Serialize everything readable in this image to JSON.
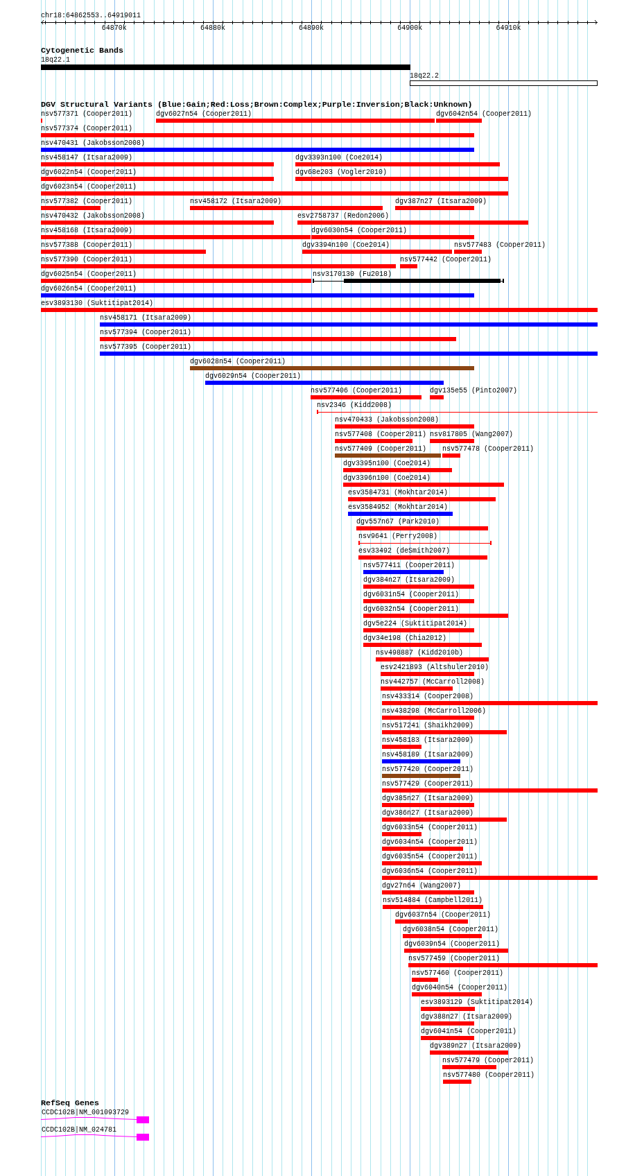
{
  "ruler": {
    "label": "chr18:64862553..64919011",
    "ticks": [
      "64870k",
      "64880k",
      "64890k",
      "64900k",
      "64910k"
    ]
  },
  "cytogenetic_bands": {
    "title": "Cytogenetic Bands",
    "bands": [
      {
        "label": "18q22.1",
        "color": "#000000"
      },
      {
        "label": "18q22.2",
        "color": "#ffffff"
      }
    ]
  },
  "dgv_variants": {
    "title": "DGV Structural Variants (Blue:Gain;Red:Loss;Brown:Complex;Purple:Inversion;Black:Unknown)",
    "rows": [
      {
        "features": [
          {
            "label": "nsv577371 (Cooper2011)",
            "color": "#ff0000",
            "kind": "bar"
          },
          {
            "label": "dgv6027n54 (Cooper2011)",
            "color": "#ff0000",
            "kind": "bar"
          },
          {
            "label": "dgv6042n54 (Cooper2011)",
            "color": "#ff0000",
            "kind": "bar"
          }
        ]
      },
      {
        "features": [
          {
            "label": "nsv577374 (Cooper2011)",
            "color": "#ff0000",
            "kind": "bar"
          }
        ]
      },
      {
        "features": [
          {
            "label": "nsv470431 (Jakobsson2008)",
            "color": "#0000ff",
            "kind": "bar"
          }
        ]
      },
      {
        "features": [
          {
            "label": "nsv458147 (Itsara2009)",
            "color": "#ff0000",
            "kind": "bar"
          },
          {
            "label": "dgv3393n100 (Coe2014)",
            "color": "#ff0000",
            "kind": "bar"
          }
        ]
      },
      {
        "features": [
          {
            "label": "dgv6022n54 (Cooper2011)",
            "color": "#ff0000",
            "kind": "bar"
          },
          {
            "label": "dgv68e203 (Vogler2010)",
            "color": "#ff0000",
            "kind": "bar"
          }
        ]
      },
      {
        "features": [
          {
            "label": "dgv6023n54 (Cooper2011)",
            "color": "#ff0000",
            "kind": "bar"
          }
        ]
      },
      {
        "features": [
          {
            "label": "nsv577382 (Cooper2011)",
            "color": "#ff0000",
            "kind": "bar"
          },
          {
            "label": "nsv458172 (Itsara2009)",
            "color": "#ff0000",
            "kind": "bar"
          },
          {
            "label": "dgv387n27 (Itsara2009)",
            "color": "#ff0000",
            "kind": "bar"
          }
        ]
      },
      {
        "features": [
          {
            "label": "nsv470432 (Jakobsson2008)",
            "color": "#ff0000",
            "kind": "bar"
          },
          {
            "label": "esv2758737 (Redon2006)",
            "color": "#ff0000",
            "kind": "bar"
          }
        ]
      },
      {
        "features": [
          {
            "label": "nsv458168 (Itsara2009)",
            "color": "#ff0000",
            "kind": "bar"
          },
          {
            "label": "dgv6030n54 (Cooper2011)",
            "color": "#ff0000",
            "kind": "bar"
          }
        ]
      },
      {
        "features": [
          {
            "label": "nsv577388 (Cooper2011)",
            "color": "#ff0000",
            "kind": "bar"
          },
          {
            "label": "dgv3394n100 (Coe2014)",
            "color": "#ff0000",
            "kind": "bar"
          },
          {
            "label": "nsv577483 (Cooper2011)",
            "color": "#ff0000",
            "kind": "bar"
          }
        ]
      },
      {
        "features": [
          {
            "label": "nsv577390 (Cooper2011)",
            "color": "#ff0000",
            "kind": "bar"
          },
          {
            "label": "nsv577442 (Cooper2011)",
            "color": "#ff0000",
            "kind": "bar"
          }
        ]
      },
      {
        "features": [
          {
            "label": "dgv6025n54 (Cooper2011)",
            "color": "#ff0000",
            "kind": "bar"
          },
          {
            "label": "nsv3170130 (Fu2018)",
            "color": "#000000",
            "kind": "partial"
          }
        ]
      },
      {
        "features": [
          {
            "label": "dgv6026n54 (Cooper2011)",
            "color": "#0000ff",
            "kind": "bar"
          }
        ]
      },
      {
        "features": [
          {
            "label": "esv3893130 (Suktitipat2014)",
            "color": "#ff0000",
            "kind": "bar"
          }
        ]
      },
      {
        "features": [
          {
            "label": "nsv458171 (Itsara2009)",
            "color": "#0000ff",
            "kind": "bar"
          }
        ]
      },
      {
        "features": [
          {
            "label": "nsv577394 (Cooper2011)",
            "color": "#ff0000",
            "kind": "bar"
          }
        ]
      },
      {
        "features": [
          {
            "label": "nsv577395 (Cooper2011)",
            "color": "#0000ff",
            "kind": "bar"
          }
        ]
      },
      {
        "features": [
          {
            "label": "dgv6028n54 (Cooper2011)",
            "color": "#8b4513",
            "kind": "bar"
          }
        ]
      },
      {
        "features": [
          {
            "label": "dgv6029n54 (Cooper2011)",
            "color": "#0000ff",
            "kind": "bar"
          }
        ]
      },
      {
        "features": [
          {
            "label": "nsv577406 (Cooper2011)",
            "color": "#ff0000",
            "kind": "bar"
          },
          {
            "label": "dgv135e55 (Pinto2007)",
            "color": "#ff0000",
            "kind": "bar"
          }
        ]
      },
      {
        "features": [
          {
            "label": "nsv2346 (Kidd2008)",
            "color": "#ff0000",
            "kind": "line"
          }
        ]
      },
      {
        "features": [
          {
            "label": "nsv470433 (Jakobsson2008)",
            "color": "#ff0000",
            "kind": "bar"
          }
        ]
      },
      {
        "features": [
          {
            "label": "nsv577408 (Cooper2011)",
            "color": "#ff0000",
            "kind": "bar"
          },
          {
            "label": "nsv817805 (Wang2007)",
            "color": "#ff0000",
            "kind": "bar"
          }
        ]
      },
      {
        "features": [
          {
            "label": "nsv577409 (Cooper2011)",
            "color": "#8b4513",
            "kind": "bar"
          },
          {
            "label": "nsv577478 (Cooper2011)",
            "color": "#ff0000",
            "kind": "bar"
          }
        ]
      },
      {
        "features": [
          {
            "label": "dgv3395n100 (Coe2014)",
            "color": "#ff0000",
            "kind": "bar"
          }
        ]
      },
      {
        "features": [
          {
            "label": "dgv3396n100 (Coe2014)",
            "color": "#ff0000",
            "kind": "bar"
          }
        ]
      },
      {
        "features": [
          {
            "label": "esv3584731 (Mokhtar2014)",
            "color": "#ff0000",
            "kind": "bar"
          }
        ]
      },
      {
        "features": [
          {
            "label": "esv3584952 (Mokhtar2014)",
            "color": "#0000ff",
            "kind": "bar"
          }
        ]
      },
      {
        "features": [
          {
            "label": "dgv557n67 (Park2010)",
            "color": "#ff0000",
            "kind": "bar"
          }
        ]
      },
      {
        "features": [
          {
            "label": "nsv9641 (Perry2008)",
            "color": "#ff0000",
            "kind": "line"
          }
        ]
      },
      {
        "features": [
          {
            "label": "esv33492 (deSmith2007)",
            "color": "#ff0000",
            "kind": "bar"
          }
        ]
      },
      {
        "features": [
          {
            "label": "nsv577411 (Cooper2011)",
            "color": "#0000ff",
            "kind": "bar"
          }
        ]
      },
      {
        "features": [
          {
            "label": "dgv384n27 (Itsara2009)",
            "color": "#ff0000",
            "kind": "bar"
          }
        ]
      },
      {
        "features": [
          {
            "label": "dgv6031n54 (Cooper2011)",
            "color": "#ff0000",
            "kind": "bar"
          }
        ]
      },
      {
        "features": [
          {
            "label": "dgv6032n54 (Cooper2011)",
            "color": "#ff0000",
            "kind": "bar"
          }
        ]
      },
      {
        "features": [
          {
            "label": "dgv5e224 (Suktitipat2014)",
            "color": "#ff0000",
            "kind": "bar"
          }
        ]
      },
      {
        "features": [
          {
            "label": "dgv34e198 (Chia2012)",
            "color": "#ff0000",
            "kind": "bar"
          }
        ]
      },
      {
        "features": [
          {
            "label": "nsv498887 (Kidd2010b)",
            "color": "#ff0000",
            "kind": "bar"
          }
        ]
      },
      {
        "features": [
          {
            "label": "esv2421893 (Altshuler2010)",
            "color": "#ff0000",
            "kind": "bar"
          }
        ]
      },
      {
        "features": [
          {
            "label": "nsv442757 (McCarroll2008)",
            "color": "#ff0000",
            "kind": "bar"
          }
        ]
      },
      {
        "features": [
          {
            "label": "nsv433314 (Cooper2008)",
            "color": "#ff0000",
            "kind": "bar"
          }
        ]
      },
      {
        "features": [
          {
            "label": "nsv438298 (McCarroll2006)",
            "color": "#ff0000",
            "kind": "bar"
          }
        ]
      },
      {
        "features": [
          {
            "label": "nsv517241 (Shaikh2009)",
            "color": "#ff0000",
            "kind": "bar"
          }
        ]
      },
      {
        "features": [
          {
            "label": "nsv458183 (Itsara2009)",
            "color": "#ff0000",
            "kind": "bar"
          }
        ]
      },
      {
        "features": [
          {
            "label": "nsv458189 (Itsara2009)",
            "color": "#0000ff",
            "kind": "bar"
          }
        ]
      },
      {
        "features": [
          {
            "label": "nsv577420 (Cooper2011)",
            "color": "#8b4513",
            "kind": "bar"
          }
        ]
      },
      {
        "features": [
          {
            "label": "nsv577429 (Cooper2011)",
            "color": "#ff0000",
            "kind": "bar"
          }
        ]
      },
      {
        "features": [
          {
            "label": "dgv385n27 (Itsara2009)",
            "color": "#ff0000",
            "kind": "bar"
          }
        ]
      },
      {
        "features": [
          {
            "label": "dgv386n27 (Itsara2009)",
            "color": "#ff0000",
            "kind": "bar"
          }
        ]
      },
      {
        "features": [
          {
            "label": "dgv6033n54 (Cooper2011)",
            "color": "#ff0000",
            "kind": "bar"
          }
        ]
      },
      {
        "features": [
          {
            "label": "dgv6034n54 (Cooper2011)",
            "color": "#ff0000",
            "kind": "bar"
          }
        ]
      },
      {
        "features": [
          {
            "label": "dgv6035n54 (Cooper2011)",
            "color": "#ff0000",
            "kind": "bar"
          }
        ]
      },
      {
        "features": [
          {
            "label": "dgv6036n54 (Cooper2011)",
            "color": "#ff0000",
            "kind": "bar"
          }
        ]
      },
      {
        "features": [
          {
            "label": "dgv27n64 (Wang2007)",
            "color": "#ff0000",
            "kind": "bar"
          }
        ]
      },
      {
        "features": [
          {
            "label": "nsv514884 (Campbell2011)",
            "color": "#ff0000",
            "kind": "bar"
          }
        ]
      },
      {
        "features": [
          {
            "label": "dgv6037n54 (Cooper2011)",
            "color": "#ff0000",
            "kind": "bar"
          }
        ]
      },
      {
        "features": [
          {
            "label": "dgv6038n54 (Cooper2011)",
            "color": "#ff0000",
            "kind": "bar"
          }
        ]
      },
      {
        "features": [
          {
            "label": "dgv6039n54 (Cooper2011)",
            "color": "#ff0000",
            "kind": "bar"
          }
        ]
      },
      {
        "features": [
          {
            "label": "nsv577459 (Cooper2011)",
            "color": "#ff0000",
            "kind": "bar"
          }
        ]
      },
      {
        "features": [
          {
            "label": "nsv577460 (Cooper2011)",
            "color": "#ff0000",
            "kind": "bar"
          }
        ]
      },
      {
        "features": [
          {
            "label": "dgv6040n54 (Cooper2011)",
            "color": "#ff0000",
            "kind": "bar"
          }
        ]
      },
      {
        "features": [
          {
            "label": "esv3893129 (Suktitipat2014)",
            "color": "#ff0000",
            "kind": "bar"
          }
        ]
      },
      {
        "features": [
          {
            "label": "dgv388n27 (Itsara2009)",
            "color": "#ff0000",
            "kind": "bar"
          }
        ]
      },
      {
        "features": [
          {
            "label": "dgv6041n54 (Cooper2011)",
            "color": "#ff0000",
            "kind": "bar"
          }
        ]
      },
      {
        "features": [
          {
            "label": "dgv389n27 (Itsara2009)",
            "color": "#ff0000",
            "kind": "bar"
          }
        ]
      },
      {
        "features": [
          {
            "label": "nsv577479 (Cooper2011)",
            "color": "#ff0000",
            "kind": "bar"
          }
        ]
      },
      {
        "features": [
          {
            "label": "nsv577480 (Cooper2011)",
            "color": "#ff0000",
            "kind": "bar"
          }
        ]
      }
    ]
  },
  "refseq_genes": {
    "title": "RefSeq Genes",
    "genes": [
      {
        "label": "CCDC102B|NM_001093729"
      },
      {
        "label": "CCDC102B|NM_024781"
      }
    ]
  }
}
